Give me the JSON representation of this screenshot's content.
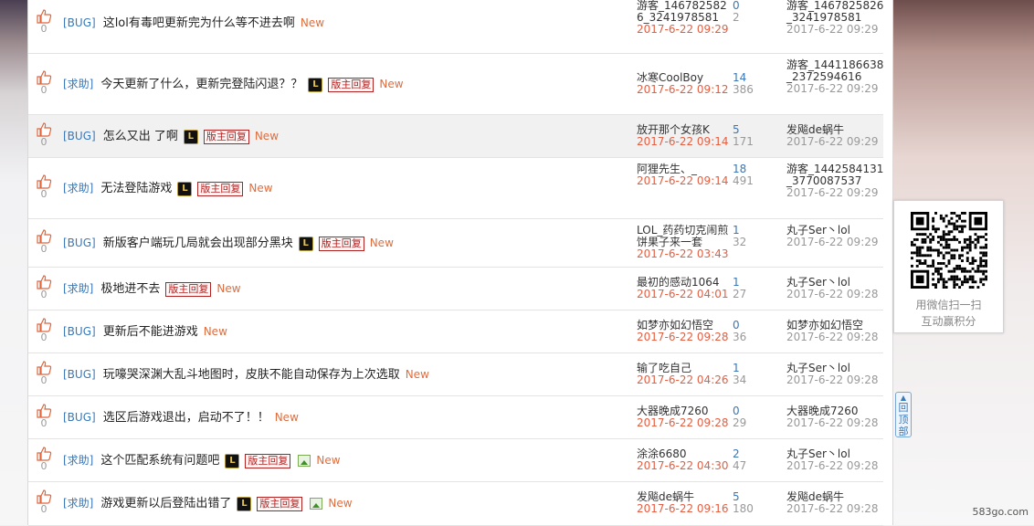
{
  "topics": [
    {
      "likes": "0",
      "tag": "[BUG]",
      "title": "这lol有毒吧更新完为什么等不进去啊",
      "official": false,
      "mod_reply": false,
      "image": false,
      "new": "New",
      "author": "游客_1467825826_3241978581",
      "author_time": "2017-6-22 09:29",
      "replies": "0",
      "views": "2",
      "last_user": "游客_1467825826_3241978581",
      "last_time": "2017-6-22 09:29"
    },
    {
      "likes": "0",
      "tag": "[求助]",
      "title": "今天更新了什么，更新完登陆闪退？？",
      "official": true,
      "mod_reply": true,
      "image": false,
      "new": "New",
      "author": "冰寒CoolBoy",
      "author_time": "2017-6-22 09:12",
      "replies": "14",
      "views": "386",
      "last_user": "游客_1441186638_2372594616",
      "last_time": "2017-6-22 09:29"
    },
    {
      "likes": "0",
      "tag": "[BUG]",
      "title": "怎么又出 了啊",
      "official": true,
      "mod_reply": true,
      "image": false,
      "new": "New",
      "author": "放开那个女孩K",
      "author_time": "2017-6-22 09:14",
      "replies": "5",
      "views": "171",
      "last_user": "发飚de蜗牛",
      "last_time": "2017-6-22 09:29"
    },
    {
      "likes": "0",
      "tag": "[求助]",
      "title": "无法登陆游戏",
      "official": true,
      "mod_reply": true,
      "image": false,
      "new": "New",
      "author": "阿狸先生、_",
      "author_time": "2017-6-22 09:14",
      "replies": "18",
      "views": "491",
      "last_user": "游客_1442584131_3770087537",
      "last_time": "2017-6-22 09:29"
    },
    {
      "likes": "0",
      "tag": "[BUG]",
      "title": "新版客户端玩几局就会出现部分黑块",
      "official": true,
      "mod_reply": true,
      "image": false,
      "new": "New",
      "author": "LOL_药药切克闹煎饼果子来一套",
      "author_time": "2017-6-22 03:43",
      "replies": "1",
      "views": "32",
      "last_user": "丸子Ser丶lol",
      "last_time": "2017-6-22 09:29"
    },
    {
      "likes": "0",
      "tag": "[求助]",
      "title": "极地进不去",
      "official": false,
      "mod_reply": true,
      "image": false,
      "new": "New",
      "author": "最初的感动1064",
      "author_time": "2017-6-22 04:01",
      "replies": "1",
      "views": "27",
      "last_user": "丸子Ser丶lol",
      "last_time": "2017-6-22 09:28"
    },
    {
      "likes": "0",
      "tag": "[BUG]",
      "title": "更新后不能进游戏",
      "official": false,
      "mod_reply": false,
      "image": false,
      "new": "New",
      "author": "如梦亦如幻悟空",
      "author_time": "2017-6-22 09:28",
      "replies": "0",
      "views": "36",
      "last_user": "如梦亦如幻悟空",
      "last_time": "2017-6-22 09:28"
    },
    {
      "likes": "0",
      "tag": "[BUG]",
      "title": "玩嚎哭深渊大乱斗地图时，皮肤不能自动保存为上次选取",
      "official": false,
      "mod_reply": false,
      "image": false,
      "new": "New",
      "author": "输了吃自己",
      "author_time": "2017-6-22 04:26",
      "replies": "1",
      "views": "34",
      "last_user": "丸子Ser丶lol",
      "last_time": "2017-6-22 09:28"
    },
    {
      "likes": "0",
      "tag": "[BUG]",
      "title": "选区后游戏退出，启动不了！！",
      "official": false,
      "mod_reply": false,
      "image": false,
      "new": "New",
      "author": "大器晚成7260",
      "author_time": "2017-6-22 09:28",
      "replies": "0",
      "views": "29",
      "last_user": "大器晚成7260",
      "last_time": "2017-6-22 09:28"
    },
    {
      "likes": "0",
      "tag": "[求助]",
      "title": "这个匹配系统有问题吧",
      "official": true,
      "mod_reply": true,
      "image": true,
      "new": "New",
      "author": "涂涂6680",
      "author_time": "2017-6-22 04:30",
      "replies": "2",
      "views": "47",
      "last_user": "丸子Ser丶lol",
      "last_time": "2017-6-22 09:28"
    },
    {
      "likes": "0",
      "tag": "[求助]",
      "title": "游戏更新以后登陆出错了",
      "official": true,
      "mod_reply": true,
      "image": true,
      "new": "New",
      "author": "发飚de蜗牛",
      "author_time": "2017-6-22 09:16",
      "replies": "5",
      "views": "180",
      "last_user": "发飚de蜗牛",
      "last_time": "2017-6-22 09:28"
    }
  ],
  "labels": {
    "official_icon": "L",
    "mod_reply": "版主回复",
    "qr_line1": "用微信扫一扫",
    "qr_line2": "互动赢积分",
    "back_to_top": "回顶部",
    "watermark": "583go.com"
  },
  "colors": {
    "tag": "#3a77b6",
    "new": "#e06d3d",
    "author_time": "#e45f42",
    "mod_reply": "#b32020"
  },
  "icons": {
    "like": "thumbs-up-icon",
    "official": "lol-logo-icon",
    "image": "image-attachment-icon",
    "qr": "qr-code-icon"
  }
}
